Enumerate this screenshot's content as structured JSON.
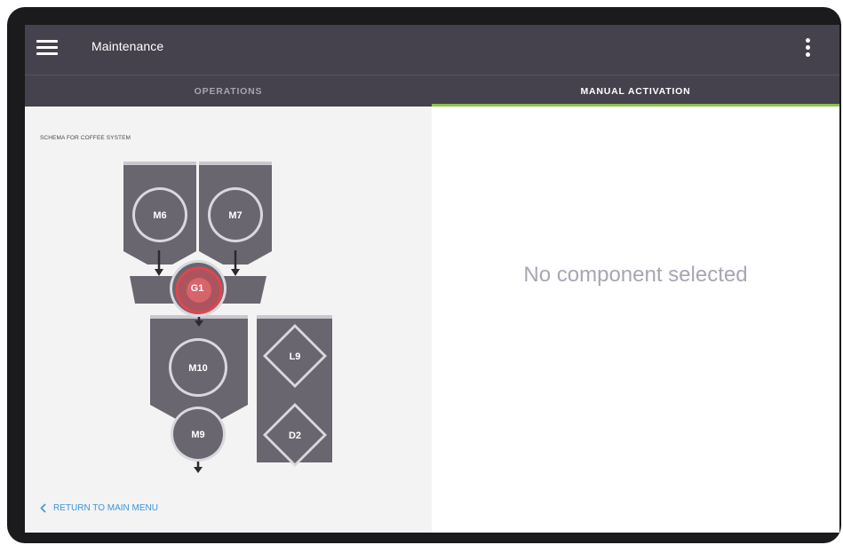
{
  "app": {
    "title": "Maintenance",
    "menu_icon": "hamburger-menu-icon",
    "more_icon": "more-vertical-icon"
  },
  "tabs": [
    {
      "label": "OPERATIONS",
      "active": false
    },
    {
      "label": "MANUAL ACTIVATION",
      "active": true
    }
  ],
  "schema": {
    "title": "SCHEMA FOR COFFEE SYSTEM",
    "components": {
      "m6": "M6",
      "m7": "M7",
      "g1": "G1",
      "m10": "M10",
      "m9": "M9",
      "l9": "L9",
      "d2": "D2"
    }
  },
  "return_link": {
    "label": "RETURN TO MAIN MENU",
    "icon": "chevron-left-icon"
  },
  "detail": {
    "empty_message": "No component selected"
  },
  "colors": {
    "appbar": "#45414d",
    "active_tab_indicator": "#8bc34a",
    "component_fill": "#6a6670",
    "component_circle": "#d9d8dc",
    "selected_ring": "#e0464f",
    "link": "#3d95d9",
    "empty_text": "#a7a6b3"
  }
}
